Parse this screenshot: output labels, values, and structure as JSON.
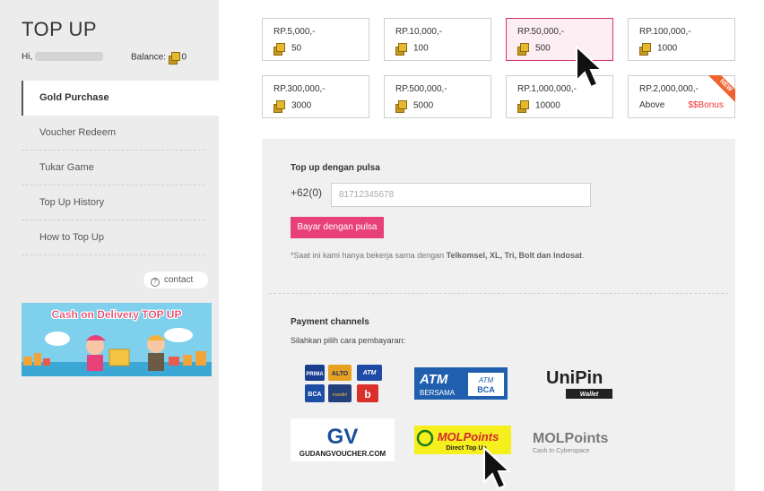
{
  "sidebar": {
    "title": "TOP UP",
    "greeting": "Hi,",
    "balance_label": "Balance:",
    "balance_value": "0",
    "nav": [
      {
        "label": "Gold Purchase",
        "active": true
      },
      {
        "label": "Voucher Redeem"
      },
      {
        "label": "Tukar Game"
      },
      {
        "label": "Top Up History"
      },
      {
        "label": "How to Top Up"
      }
    ],
    "contact_label": "contact",
    "banner_title": "Cash on Delivery TOP UP"
  },
  "packages": [
    {
      "price": "RP.5,000,-",
      "gold": "50"
    },
    {
      "price": "RP.10,000,-",
      "gold": "100"
    },
    {
      "price": "RP.50,000,-",
      "gold": "500",
      "selected": true
    },
    {
      "price": "RP.100,000,-",
      "gold": "1000"
    },
    {
      "price": "RP.300,000,-",
      "gold": "3000"
    },
    {
      "price": "RP.500,000,-",
      "gold": "5000"
    },
    {
      "price": "RP.1,000,000,-",
      "gold": "10000"
    },
    {
      "price": "RP.2,000,000,-",
      "gold": "Above",
      "bonus": "$$Bonus",
      "badge": "NEW"
    }
  ],
  "pulsa": {
    "heading": "Top up dengan pulsa",
    "prefix": "+62(0)",
    "placeholder": "81712345678",
    "button": "Bayar dengan pulsa",
    "note_prefix": "*Saat ini kami hanya bekerja sama dengan ",
    "note_operators": "Telkomsel, XL, Tri, Bolt dan Indosat",
    "note_suffix": "."
  },
  "payment": {
    "heading": "Payment channels",
    "subtitle": "Silahkan pilih cara pembayaran:",
    "channels": [
      {
        "name": "bank-transfer",
        "labels": [
          "PRIMA",
          "ALTO",
          "ATM",
          "BCA",
          "mandiri",
          "b"
        ]
      },
      {
        "name": "atm-bersama-bca",
        "labels": [
          "ATM",
          "BERSAMA",
          "ATM",
          "BCA"
        ]
      },
      {
        "name": "unipin-wallet",
        "labels": [
          "UniPin",
          "Wallet"
        ]
      },
      {
        "name": "gudang-voucher",
        "labels": [
          "GV",
          "GUDANGVOUCHER.COM"
        ]
      },
      {
        "name": "molpoints-direct",
        "labels": [
          "MOLPoints",
          "Direct Top Up"
        ]
      },
      {
        "name": "molpoints-cyberspace",
        "labels": [
          "MOLPoints",
          "Cash In Cyberspace"
        ]
      }
    ]
  },
  "colors": {
    "accent_pink": "#e8417a",
    "selected_border": "#d9306b",
    "sidebar_bg": "#ececec",
    "panel_bg": "#f0f0f0"
  }
}
